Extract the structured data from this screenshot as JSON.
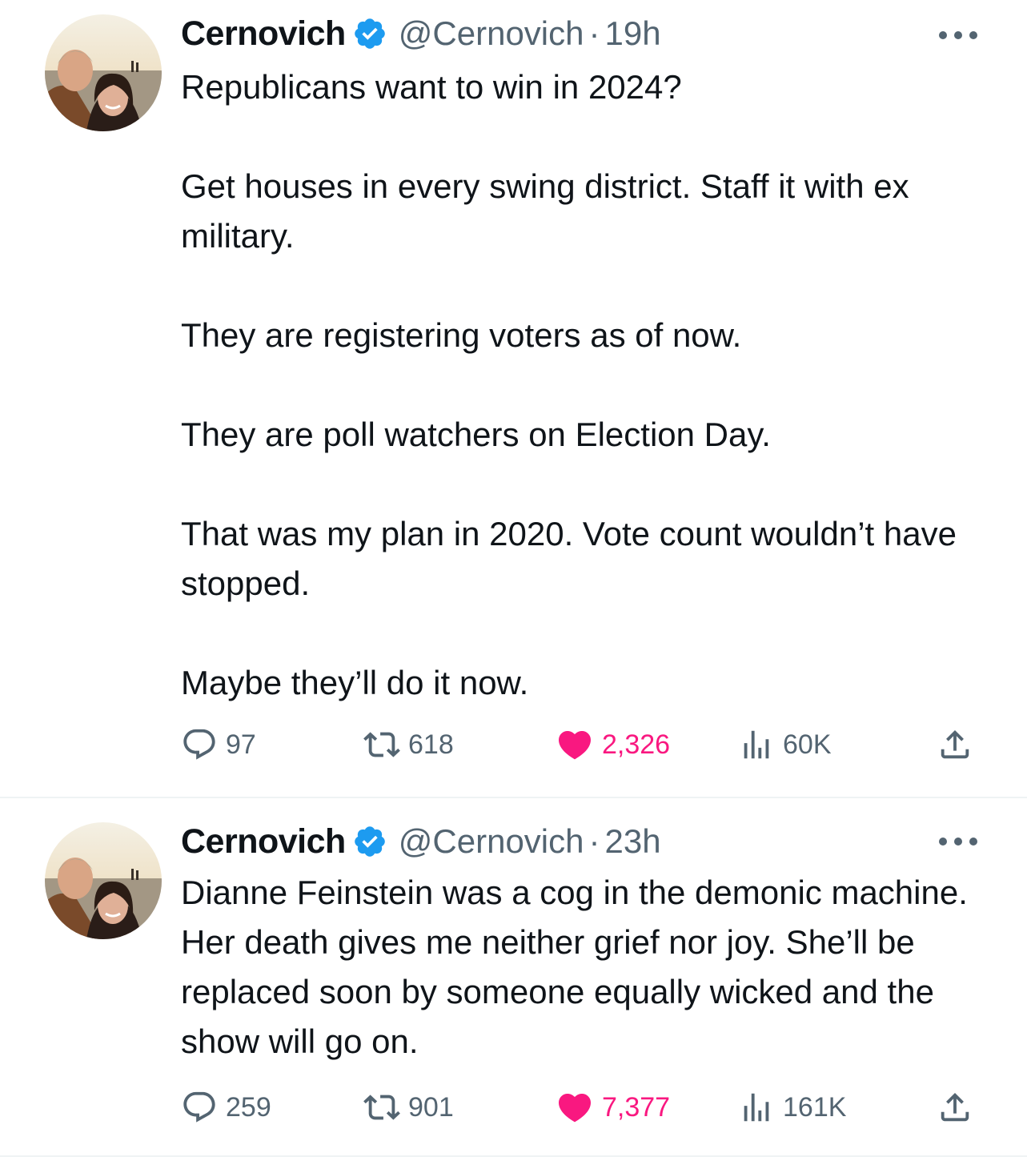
{
  "colors": {
    "text": "#0f1419",
    "secondary": "#536471",
    "like": "#f91880",
    "verified": "#1d9bf0",
    "divider": "#eff3f4"
  },
  "icons": {
    "reply": "speech-bubble-icon",
    "retweet": "retweet-icon",
    "like": "heart-filled-icon",
    "views": "bar-chart-icon",
    "share": "share-upload-icon",
    "more": "ellipsis-icon",
    "verified": "verified-badge-icon"
  },
  "tweets": [
    {
      "name": "Cernovich",
      "handle": "@Cernovich",
      "separator": "·",
      "time": "19h",
      "text": "Republicans want to win in 2024?\n\nGet houses in every swing district. Staff it with ex military.\n\nThey are registering voters as of now.\n\nThey are poll watchers on Election Day.\n\nThat was my plan in 2020. Vote count wouldn’t have stopped.\n\nMaybe they’ll do it now.",
      "replies": "97",
      "retweets": "618",
      "likes": "2,326",
      "views": "60K"
    },
    {
      "name": "Cernovich",
      "handle": "@Cernovich",
      "separator": "·",
      "time": "23h",
      "text": "Dianne Feinstein was a cog in the demonic machine. Her death gives me neither grief nor joy. She’ll be replaced soon by someone equally wicked and the show will go on.",
      "replies": "259",
      "retweets": "901",
      "likes": "7,377",
      "views": "161K"
    }
  ]
}
